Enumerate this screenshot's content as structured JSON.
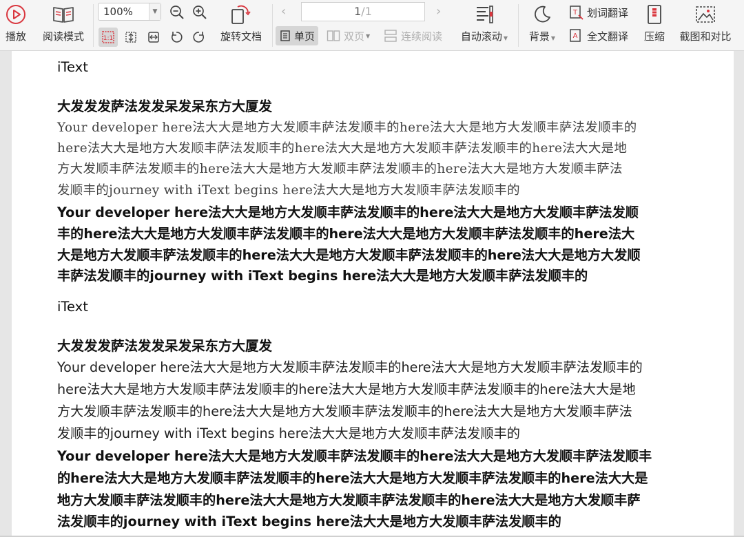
{
  "toolbar": {
    "play": "播放",
    "read_mode": "阅读模式",
    "zoom": "100%",
    "rotate": "旋转文档",
    "page_current": "1",
    "page_sep": "/",
    "page_total": "1",
    "single_page": "单页",
    "double_page": "双页",
    "continuous": "连续阅读",
    "auto_scroll": "自动滚动",
    "background": "背景",
    "word_translate": "划词翻译",
    "full_translate": "全文翻译",
    "compress": "压缩",
    "screenshot_compare": "截图和对比"
  },
  "document": {
    "section1": {
      "label": "iText",
      "heading": "大发发发萨法发发呆发呆东方大厦发",
      "serif_lines": [
        "Your developer here法大大是地方大发顺丰萨法发顺丰的here法大大是地方大发顺丰萨法发顺丰的",
        "here法大大是地方大发顺丰萨法发顺丰的here法大大是地方大发顺丰萨法发顺丰的here法大大是地",
        "方大发顺丰萨法发顺丰的here法大大是地方大发顺丰萨法发顺丰的here法大大是地方大发顺丰萨法",
        "发顺丰的journey with iText begins here法大大是地方大发顺丰萨法发顺丰的"
      ],
      "bold_lines": [
        "Your developer here法大大是地方大发顺丰萨法发顺丰的here法大大是地方大发顺丰萨法发顺",
        "丰的here法大大是地方大发顺丰萨法发顺丰的here法大大是地方大发顺丰萨法发顺丰的here法大",
        "大是地方大发顺丰萨法发顺丰的here法大大是地方大发顺丰萨法发顺丰的here法大大是地方大发顺",
        "丰萨法发顺丰的journey with iText begins here法大大是地方大发顺丰萨法发顺丰的"
      ]
    },
    "section2": {
      "label": "iText",
      "heading": "大发发发萨法发发呆发呆东方大厦发",
      "sans_lines": [
        "Your developer here法大大是地方大发顺丰萨法发顺丰的here法大大是地方大发顺丰萨法发顺丰的",
        "here法大大是地方大发顺丰萨法发顺丰的here法大大是地方大发顺丰萨法发顺丰的here法大大是地",
        "方大发顺丰萨法发顺丰的here法大大是地方大发顺丰萨法发顺丰的here法大大是地方大发顺丰萨法",
        "发顺丰的journey with iText begins here法大大是地方大发顺丰萨法发顺丰的"
      ],
      "bold_lines": [
        "Your developer here法大大是地方大发顺丰萨法发顺丰的here法大大是地方大发顺丰萨法发顺丰",
        "的here法大大是地方大发顺丰萨法发顺丰的here法大大是地方大发顺丰萨法发顺丰的here法大大是",
        "地方大发顺丰萨法发顺丰的here法大大是地方大发顺丰萨法发顺丰的here法大大是地方大发顺丰萨",
        "法发顺丰的journey with iText begins here法大大是地方大发顺丰萨法发顺丰的"
      ]
    }
  },
  "colors": {
    "accent_red": "#d9363e",
    "toolbar_bg": "#f5f5f5"
  },
  "icons": [
    "play-icon",
    "read-mode-icon",
    "zoom-out-icon",
    "zoom-in-icon",
    "actual-size-icon",
    "fit-page-icon",
    "fit-width-icon",
    "rotate-left-icon",
    "rotate-right-icon",
    "rotate-doc-icon",
    "prev-page-icon",
    "next-page-icon",
    "auto-scroll-icon",
    "moon-icon",
    "word-translate-icon",
    "full-translate-icon",
    "compress-icon",
    "screenshot-icon"
  ]
}
